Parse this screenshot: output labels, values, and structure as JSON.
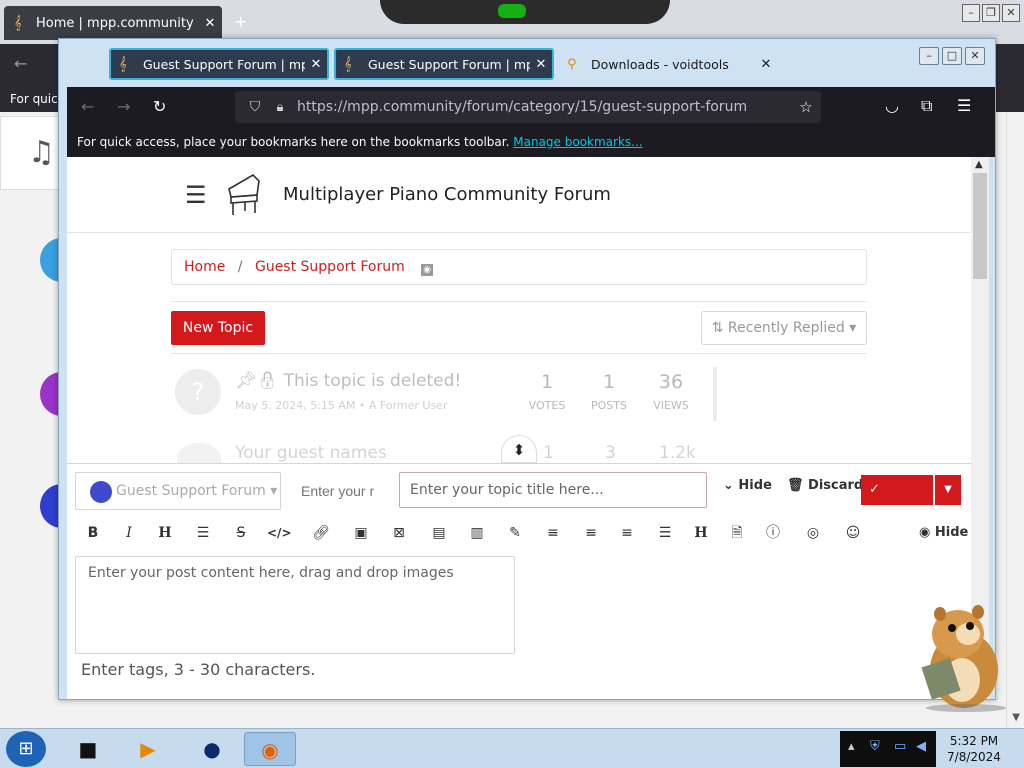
{
  "background_window": {
    "tab_title": "Home | mpp.community",
    "bookmarks_text": "For quick"
  },
  "foreground_window": {
    "tabs": [
      {
        "label": "Guest Support Forum | mpp.co",
        "icon": "treble-clef-icon",
        "active": true
      },
      {
        "label": "Guest Support Forum | mpp.co",
        "icon": "treble-clef-icon",
        "active": false
      },
      {
        "label": "Downloads - voidtools",
        "icon": "search-magnifier-icon",
        "active": false
      }
    ],
    "url": "https://mpp.community/forum/category/15/guest-support-forum",
    "bookmarks_bar": {
      "text": "For quick access, place your bookmarks here on the bookmarks toolbar.",
      "link": "Manage bookmarks..."
    }
  },
  "site": {
    "title": "Multiplayer Piano Community Forum"
  },
  "breadcrumb": {
    "home": "Home",
    "separator": "/",
    "current": "Guest Support Forum"
  },
  "actions": {
    "new_topic": "New Topic",
    "sort": "Recently Replied"
  },
  "topics": [
    {
      "title": "This topic is deleted!",
      "meta": "May 5, 2024, 5:15 AM • A Former User",
      "votes": "1",
      "votes_label": "VOTES",
      "posts": "1",
      "posts_label": "POSTS",
      "views": "36",
      "views_label": "VIEWS"
    },
    {
      "title": "Your guest names",
      "votes": "1",
      "posts": "3",
      "views": "1.2k"
    }
  ],
  "composer": {
    "category": "Guest Support Forum",
    "handle_placeholder": "Enter your r",
    "title_placeholder": "Enter your topic title here...",
    "hide": "Hide",
    "discard": "Discard",
    "submit": "Submit",
    "hide_preview": "Hide I",
    "post_placeholder": "Enter your post content here, drag and drop images",
    "tags_placeholder": "Enter tags, 3 - 30 characters.",
    "toolbar_icons": [
      "bold-icon",
      "italic-icon",
      "heading-icon",
      "list-icon",
      "strikethrough-icon",
      "code-icon",
      "link-icon",
      "image-icon",
      "grid-icon",
      "card-icon",
      "chart-icon",
      "pen-icon",
      "align-left-icon",
      "align-center-icon",
      "align-right-icon",
      "align-justify-icon",
      "header-icon",
      "file-icon",
      "info-icon",
      "eye-slash-icon",
      "emoji-icon"
    ]
  },
  "taskbar": {
    "time": "5:32 PM",
    "date": "7/8/2024"
  },
  "colors": {
    "brand_red": "#d4191c",
    "link_red": "#c9211e",
    "firefox_dark": "#1c1b22",
    "active_tab_border": "#35b4d8"
  }
}
